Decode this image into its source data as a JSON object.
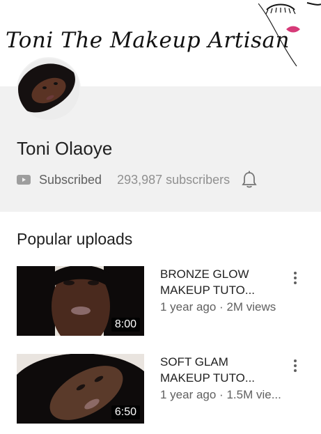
{
  "banner": {
    "title": "Toni The Makeup Artisan"
  },
  "channel": {
    "name": "Toni Olaoye",
    "subscribed_label": "Subscribed",
    "subscriber_count": "293,987 subscribers"
  },
  "popular": {
    "title": "Popular uploads",
    "videos": [
      {
        "title_line1": "BRONZE GLOW",
        "title_line2": "MAKEUP TUTO...",
        "meta": "1 year ago · 2M views",
        "duration": "8:00"
      },
      {
        "title_line1": "SOFT GLAM",
        "title_line2": "MAKEUP TUTO...",
        "meta": "1 year ago · 1.5M vie...",
        "duration": "6:50"
      }
    ]
  },
  "icons": {
    "subscribed": "youtube-play-icon",
    "notifications": "bell-icon",
    "video_menu": "more-vert-icon"
  },
  "colors": {
    "header_background": "#f1f1f1",
    "lip_accent": "#d63a78"
  }
}
